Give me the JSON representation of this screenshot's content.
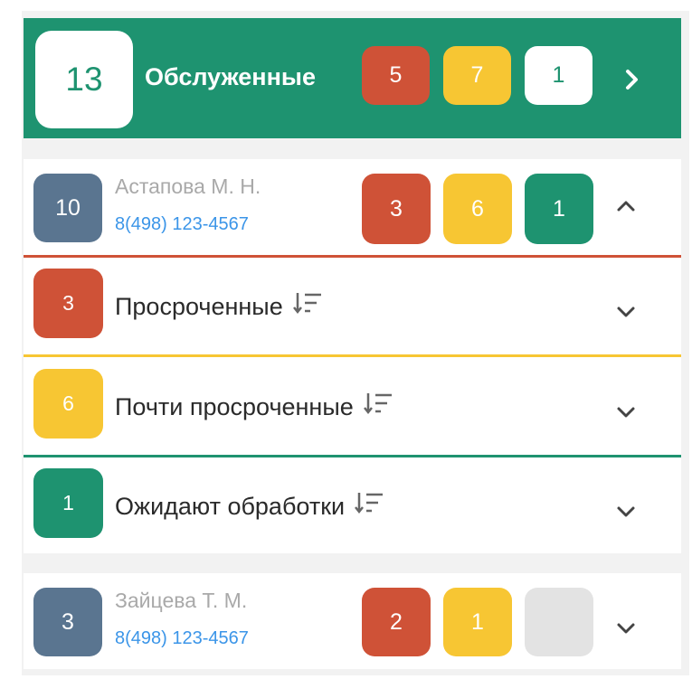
{
  "header": {
    "count": "13",
    "title": "Обслуженные",
    "badges": [
      "5",
      "7",
      "1"
    ],
    "arrow_icon": "chevron-right-icon"
  },
  "doctors": [
    {
      "count": "10",
      "name": "Астапова М. Н.",
      "phone": "8(498) 123-4567",
      "badges": [
        "3",
        "6",
        "1"
      ],
      "expanded": true,
      "categories": [
        {
          "count": "3",
          "label": "Просроченные",
          "color": "#cf5237"
        },
        {
          "count": "6",
          "label": "Почти просроченные",
          "color": "#f7c633"
        },
        {
          "count": "1",
          "label": "Ожидают обработки",
          "color": "#1e9370"
        }
      ]
    },
    {
      "count": "3",
      "name": "Зайцева Т. М.",
      "phone": "8(498) 123-4567",
      "badges": [
        "2",
        "1",
        ""
      ],
      "expanded": false
    }
  ],
  "colors": {
    "green": "#1e9370",
    "red": "#cf5237",
    "yellow": "#f7c633",
    "avatar": "#5a7590",
    "link": "#3b95e8"
  }
}
